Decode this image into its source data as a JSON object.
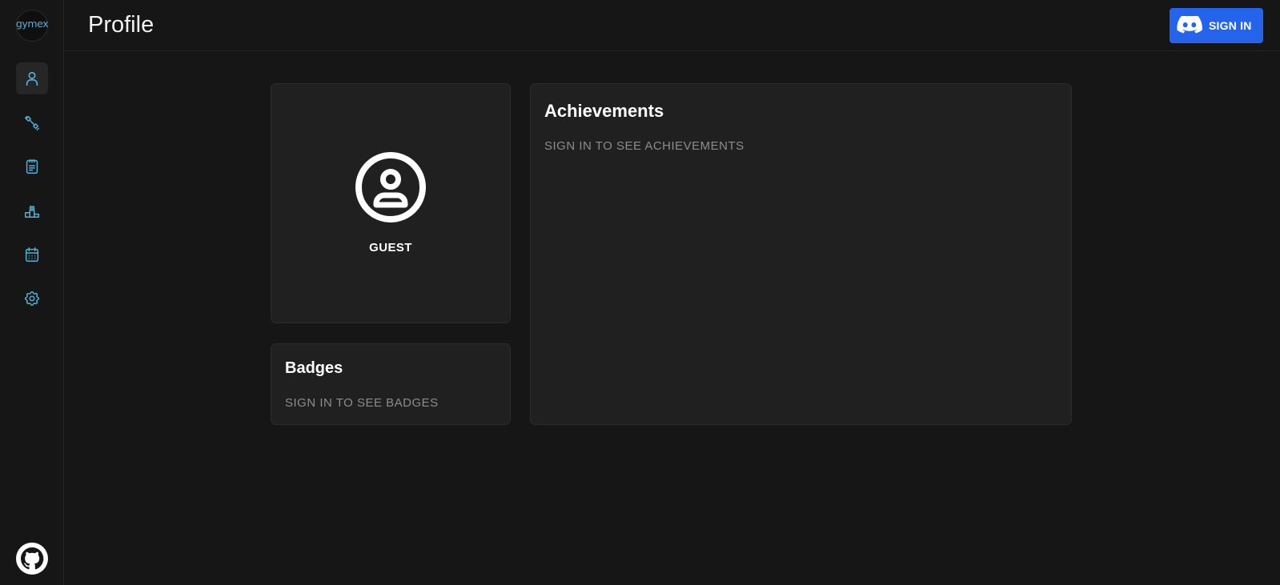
{
  "app": {
    "logo_text": "gymex"
  },
  "sidebar": {
    "items": [
      {
        "name": "profile",
        "icon": "user-icon",
        "active": true
      },
      {
        "name": "exercises",
        "icon": "dumbbell-icon",
        "active": false
      },
      {
        "name": "workouts",
        "icon": "clipboard-icon",
        "active": false
      },
      {
        "name": "leaderboard",
        "icon": "podium-icon",
        "active": false
      },
      {
        "name": "calendar",
        "icon": "calendar-icon",
        "active": false
      },
      {
        "name": "settings",
        "icon": "gear-icon",
        "active": false
      }
    ],
    "footer_icon": "github-icon"
  },
  "header": {
    "title": "Profile",
    "signin_label": "SIGN IN",
    "signin_icon": "discord-icon"
  },
  "profile": {
    "username": "GUEST",
    "avatar_icon": "user-circle-icon"
  },
  "badges": {
    "title": "Badges",
    "empty_text": "SIGN IN TO SEE BADGES"
  },
  "achievements": {
    "title": "Achievements",
    "empty_text": "SIGN IN TO SEE ACHIEVEMENTS"
  },
  "colors": {
    "background": "#161616",
    "card": "#202020",
    "accent_icon": "#4fb3d9",
    "signin_button": "#2463eb",
    "muted_text": "#8c8c8c"
  }
}
